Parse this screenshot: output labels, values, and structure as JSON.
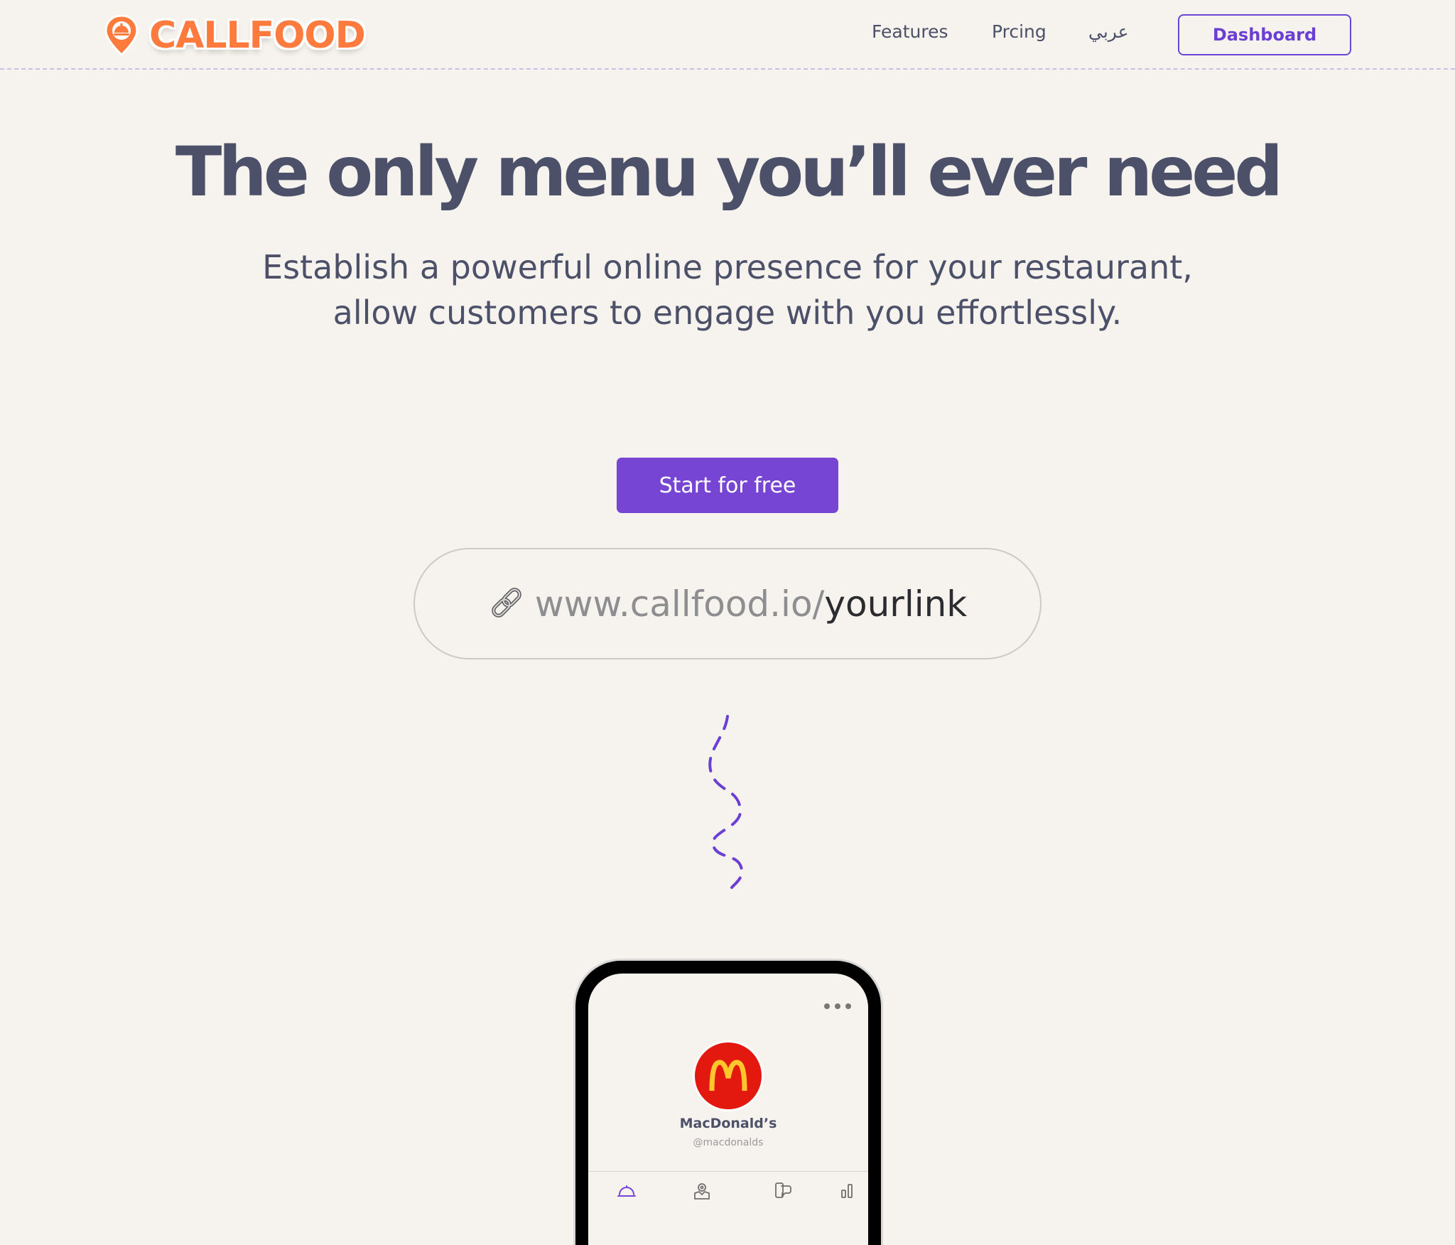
{
  "header": {
    "brand": "CALLFOOD",
    "nav": {
      "features": "Features",
      "pricing": "Prcing",
      "arabic": "عربي"
    },
    "dashboard_label": "Dashboard"
  },
  "hero": {
    "title": "The only menu you’ll ever need",
    "subtitle_line1": "Establish a powerful online presence for your restaurant,",
    "subtitle_line2": "allow customers to engage with you effortlessly.",
    "cta_label": "Start for free",
    "link_base": "www.callfood.io/",
    "link_slug": "yourlink"
  },
  "phone": {
    "restaurant_name": "MacDonald’s",
    "restaurant_handle": "@macdonalds",
    "tabs": [
      "menu-icon",
      "map-icon",
      "chat-icon",
      "stats-icon"
    ]
  },
  "colors": {
    "background": "#f6f3ee",
    "brand_orange": "#ff7a3d",
    "accent_purple": "#7645d3",
    "text_dark": "#4c5169",
    "logo_red": "#e3190f",
    "logo_yellow": "#ffc72c"
  }
}
